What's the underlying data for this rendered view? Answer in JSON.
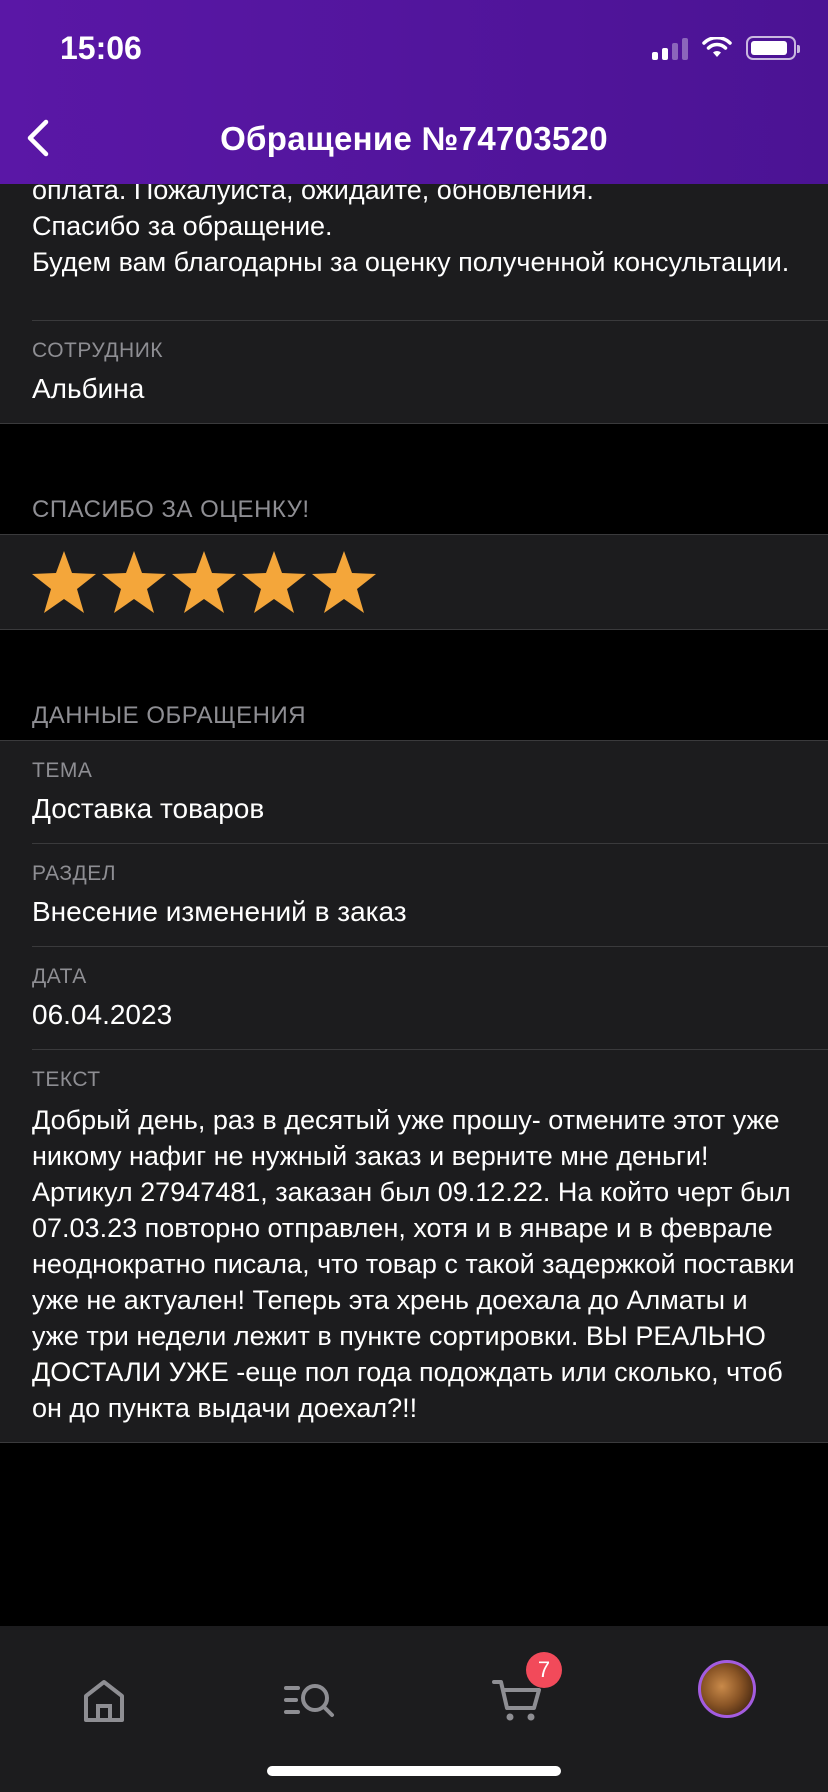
{
  "status_bar": {
    "time": "15:06"
  },
  "header": {
    "title": "Обращение №74703520"
  },
  "message": {
    "partial_line": "оплата. Пожалуйста, ожидайте, обновления.",
    "line_thanks": "Спасибо за обращение.",
    "line_rate": "Будем вам благодарны за оценку полученной консультации."
  },
  "employee": {
    "label": "СОТРУДНИК",
    "value": "Альбина"
  },
  "rating": {
    "label": "СПАСИБО ЗА ОЦЕНКУ!",
    "stars": 5,
    "max": 5,
    "star_color": "#f4a63a"
  },
  "details": {
    "section_label": "ДАННЫЕ ОБРАЩЕНИЯ",
    "fields": [
      {
        "label": "ТЕМА",
        "value": "Доставка товаров"
      },
      {
        "label": "РАЗДЕЛ",
        "value": "Внесение изменений в заказ"
      },
      {
        "label": "ДАТА",
        "value": "06.04.2023"
      },
      {
        "label": "ТЕКСТ",
        "value": "Добрый день, раз в десятый уже прошу- отмените этот уже никому нафиг не нужный заказ и верните мне деньги! Артикул 27947481, заказан был 09.12.22. На който черт был 07.03.23 повторно отправлен, хотя и в январе и в феврале неоднократно писала, что товар с такой задержкой поставки уже не актуален! Теперь эта хрень доехала до Алматы и уже три недели лежит в пункте сортировки. ВЫ РЕАЛЬНО ДОСТАЛИ УЖЕ  -еще пол года подождать или сколько, чтоб он до пункта выдачи доехал?!!"
      }
    ]
  },
  "tabbar": {
    "home_icon": "home-icon",
    "catalog_icon": "catalog-search-icon",
    "cart_icon": "cart-icon",
    "cart_badge": "7",
    "profile_icon": "avatar"
  },
  "colors": {
    "header": "#5a17a6",
    "badge": "#f24a5a",
    "accent_avatar_ring": "#a35ce0"
  }
}
